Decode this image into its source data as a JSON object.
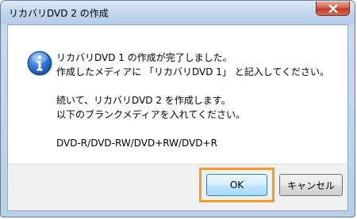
{
  "window": {
    "title": "リカバリDVD 2 の作成"
  },
  "message": {
    "line1": "リカバリDVD 1 の作成が完了しました。",
    "line2": "作成したメディアに 「リカバリDVD 1」 と記入してください。",
    "line3": "続いて、リカバリDVD 2 を作成します。",
    "line4": "以下のブランクメディアを入れてください。",
    "line5": "DVD-R/DVD-RW/DVD+RW/DVD+R"
  },
  "buttons": {
    "ok_label": "OK",
    "cancel_label": "キャンセル"
  },
  "colors": {
    "highlight": "#f39c2c",
    "info_icon": "#1f5fb5"
  },
  "icons": {
    "message": "info-icon",
    "close": "close-icon"
  }
}
